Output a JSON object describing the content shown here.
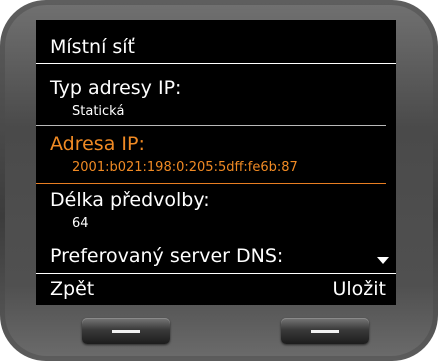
{
  "screen": {
    "title": "Místní síť",
    "items": [
      {
        "label": "Typ adresy IP:",
        "value": "Statická"
      },
      {
        "label": "Adresa IP:",
        "value": "2001:b021:198:0:205:5dff:fe6b:87",
        "selected": true
      },
      {
        "label": "Délka předvolby:",
        "value": "64"
      },
      {
        "label": "Preferovaný server DNS:",
        "value": ""
      }
    ],
    "scroll_icon": "scroll-down-arrow",
    "softkeys": {
      "left": "Zpět",
      "right": "Uložit"
    }
  },
  "colors": {
    "selected": "#f08a24",
    "screen_background": "#000000",
    "text": "#ffffff"
  }
}
